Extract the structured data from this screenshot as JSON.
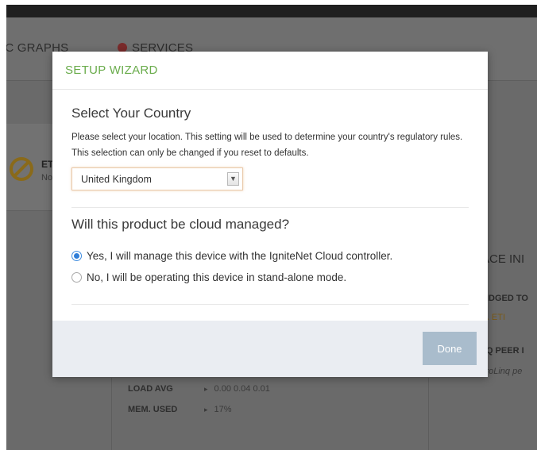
{
  "background": {
    "nav": {
      "graphs_label": "IC GRAPHS",
      "services_label": "SERVICES"
    },
    "status_card": {
      "title": "ET",
      "subtitle": "No"
    },
    "stats": {
      "load_avg_label": "LOAD AVG",
      "load_avg_value": "0.00 0.04 0.01",
      "mem_used_label": "MEM. USED",
      "mem_used_value": "17%"
    },
    "interface_title": "ACE INI",
    "bridged_label": "RIDGED TO",
    "warning_text": "⚠ ETI",
    "peer_label": "NQ PEER I",
    "peer_sub": "the NetroLinq pe"
  },
  "modal": {
    "title": "SETUP WIZARD",
    "country": {
      "heading": "Select Your Country",
      "description": "Please select your location. This setting will be used to determine your country's regulatory rules. This selection can only be changed if you reset to defaults.",
      "selected_country": "United Kingdom"
    },
    "cloud": {
      "heading": "Will this product be cloud managed?",
      "option_yes": "Yes, I will manage this device with the IgniteNet Cloud controller.",
      "option_no": "No, I will be operating this device in stand-alone mode.",
      "selected": "yes"
    },
    "done_label": "Done"
  },
  "colors": {
    "title_green": "#6aac4c",
    "done_button": "#a9bccc",
    "footer_bg": "#eaedf2",
    "radio_blue": "#2f7ed8"
  }
}
